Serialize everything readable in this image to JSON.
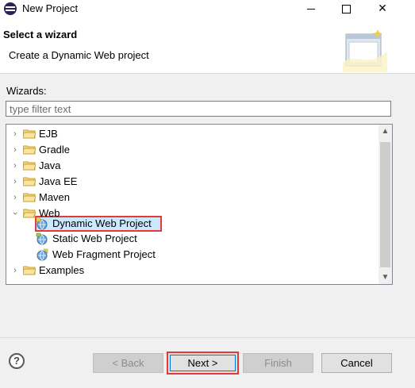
{
  "window": {
    "title": "New Project"
  },
  "header": {
    "title": "Select a wizard",
    "description": "Create a Dynamic Web project"
  },
  "body": {
    "wizards_label": "Wizards:",
    "filter_placeholder": "type filter text"
  },
  "tree": {
    "items": [
      {
        "label": "EJB",
        "expanded": false
      },
      {
        "label": "Gradle",
        "expanded": false
      },
      {
        "label": "Java",
        "expanded": false
      },
      {
        "label": "Java EE",
        "expanded": false
      },
      {
        "label": "Maven",
        "expanded": false
      },
      {
        "label": "Web",
        "expanded": true
      },
      {
        "label": "Dynamic Web Project",
        "selected": true
      },
      {
        "label": "Static Web Project"
      },
      {
        "label": "Web Fragment Project"
      },
      {
        "label": "Examples",
        "expanded": false
      }
    ]
  },
  "buttons": {
    "help": "?",
    "back": "< Back",
    "next": "Next >",
    "finish": "Finish",
    "cancel": "Cancel"
  },
  "colors": {
    "highlight_border": "#e53935",
    "selection_bg": "#cce8ff",
    "folder": "#e8b84a"
  }
}
